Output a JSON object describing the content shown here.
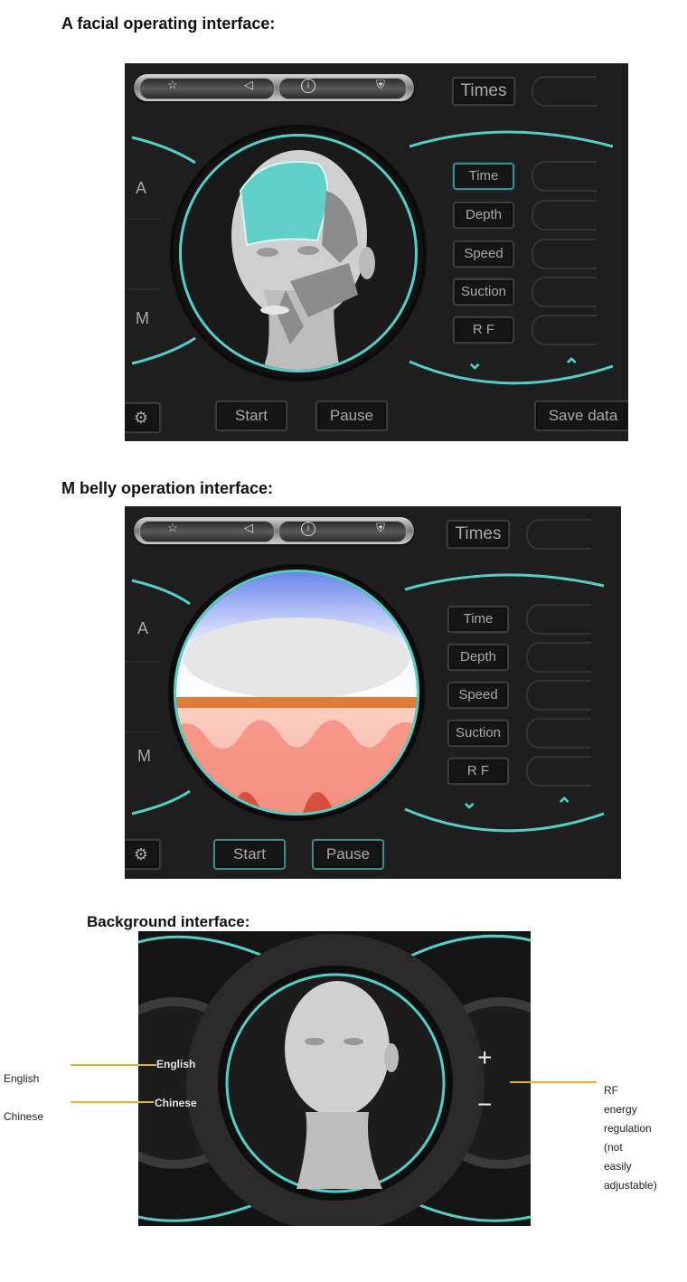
{
  "sections": [
    {
      "title": "A facial operating interface:",
      "toolbar": {
        "icons": [
          "star-icon",
          "speaker-icon",
          "info-icon",
          "shield-plus-icon"
        ]
      },
      "times_label": "Times",
      "mode_labels": [
        "A",
        "M"
      ],
      "params": [
        "Time",
        "Depth",
        "Speed",
        "Suction",
        "R F"
      ],
      "selected_param": "Time",
      "arrows": [
        "chevron-down-icon",
        "chevron-up-icon"
      ],
      "bottom": {
        "settings_icon": "gear-icon",
        "start": "Start",
        "pause": "Pause",
        "save": "Save data"
      },
      "display": "face-zones"
    },
    {
      "title": "M belly operation interface:",
      "toolbar": {
        "icons": [
          "star-icon",
          "speaker-icon",
          "info-icon",
          "shield-plus-icon"
        ]
      },
      "times_label": "Times",
      "mode_labels": [
        "A",
        "M"
      ],
      "params": [
        "Time",
        "Depth",
        "Speed",
        "Suction",
        "R F"
      ],
      "arrows": [
        "chevron-down-icon",
        "chevron-up-icon"
      ],
      "bottom": {
        "settings_icon": "gear-icon",
        "start": "Start",
        "pause": "Pause"
      },
      "display": "skin-layers"
    }
  ],
  "background": {
    "title": "Background interface:",
    "lang_options": [
      "English",
      "Chinese"
    ],
    "plus": "+",
    "minus": "−",
    "annotations": {
      "english": "English",
      "chinese": "Chinese",
      "rf": [
        "RF energy",
        "regulation",
        "(not easily",
        "adjustable)"
      ]
    }
  },
  "colors": {
    "teal": "#4fd1c5",
    "panel": "#1e1e1e",
    "annotation_line": "#e6b422"
  }
}
